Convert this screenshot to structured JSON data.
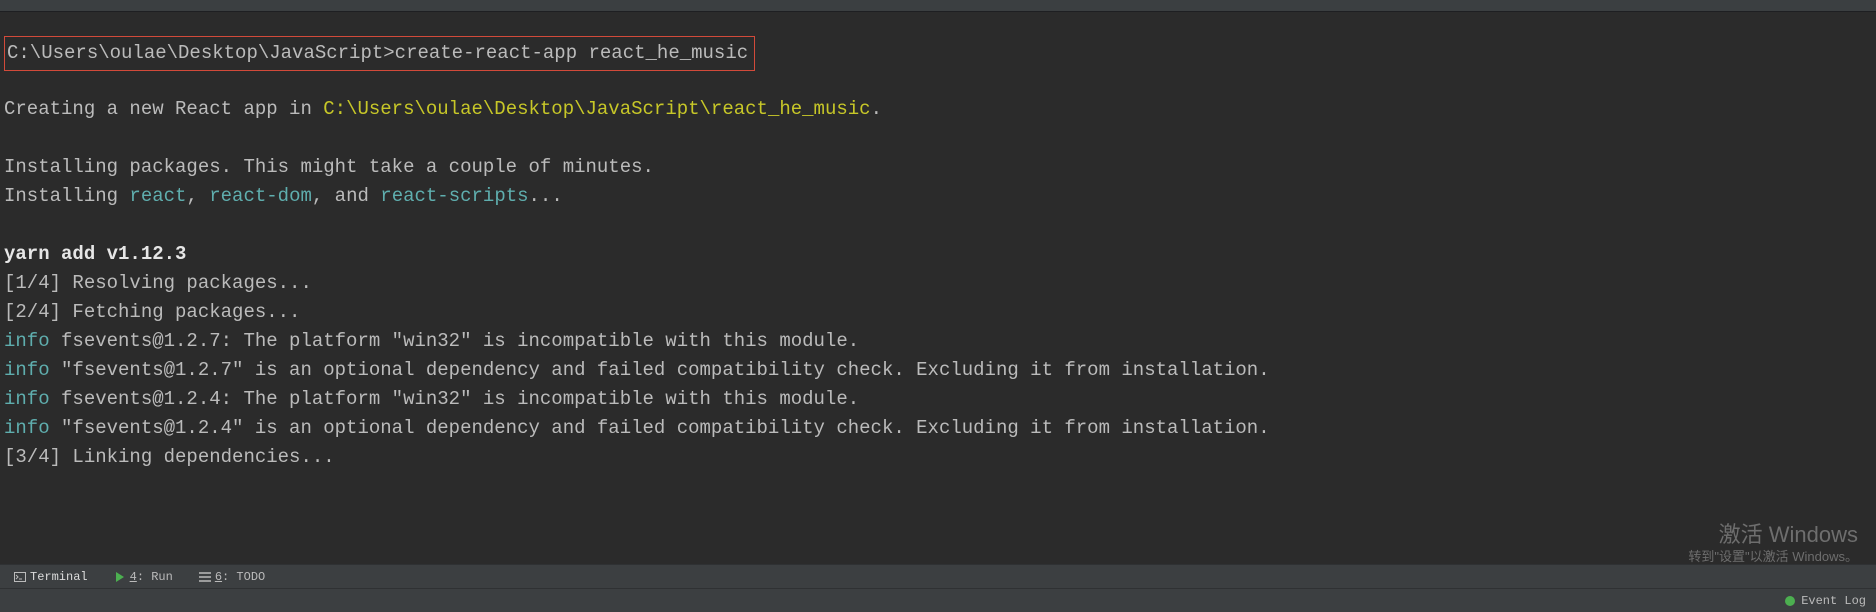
{
  "prompt": "C:\\Users\\oulae\\Desktop\\JavaScript>",
  "command": "create-react-app react_he_music",
  "creating": {
    "prefix": "Creating a new React app in ",
    "path": "C:\\Users\\oulae\\Desktop\\JavaScript\\react_he_music",
    "suffix": "."
  },
  "installing_msg": "Installing packages. This might take a couple of minutes.",
  "installing_pkgs": {
    "prefix": "Installing ",
    "p1": "react",
    "sep1": ", ",
    "p2": "react-dom",
    "sep2": ", and ",
    "p3": "react-scripts",
    "suffix": "..."
  },
  "yarn_line": "yarn add v1.12.3",
  "steps": {
    "s1": "[1/4] Resolving packages...",
    "s2": "[2/4] Fetching packages...",
    "s3": "[3/4] Linking dependencies..."
  },
  "info_label": "info",
  "info_lines": {
    "l1": " fsevents@1.2.7: The platform \"win32\" is incompatible with this module.",
    "l2": " \"fsevents@1.2.7\" is an optional dependency and failed compatibility check. Excluding it from installation.",
    "l3": " fsevents@1.2.4: The platform \"win32\" is incompatible with this module.",
    "l4": " \"fsevents@1.2.4\" is an optional dependency and failed compatibility check. Excluding it from installation."
  },
  "tabs": {
    "terminal": "Terminal",
    "run_prefix": "4",
    "run_label": ": Run",
    "todo_prefix": "6",
    "todo_label": ": TODO"
  },
  "status": {
    "event_log": "Event Log"
  },
  "watermark": {
    "title": "激活 Windows",
    "sub": "转到\"设置\"以激活 Windows。"
  }
}
